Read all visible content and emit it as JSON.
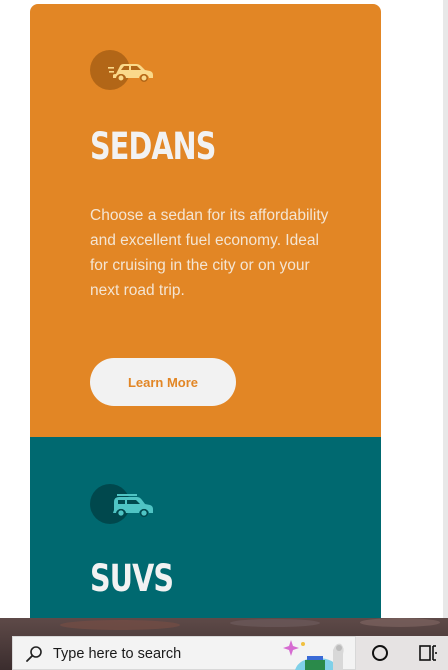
{
  "cards": [
    {
      "title": "SEDANS",
      "description": "Choose a sedan for its affordability and excellent fuel economy. Ideal for cruising in the city or on your next road trip.",
      "button_label": "Learn More",
      "icon": "sedan-car-icon",
      "color": "#e28625"
    },
    {
      "title": "SUVS",
      "icon": "suv-car-icon",
      "color": "#006970"
    }
  ],
  "taskbar": {
    "search_placeholder": "Type here to search",
    "icons": [
      "search-icon",
      "cortana-icon",
      "task-view-icon"
    ]
  }
}
